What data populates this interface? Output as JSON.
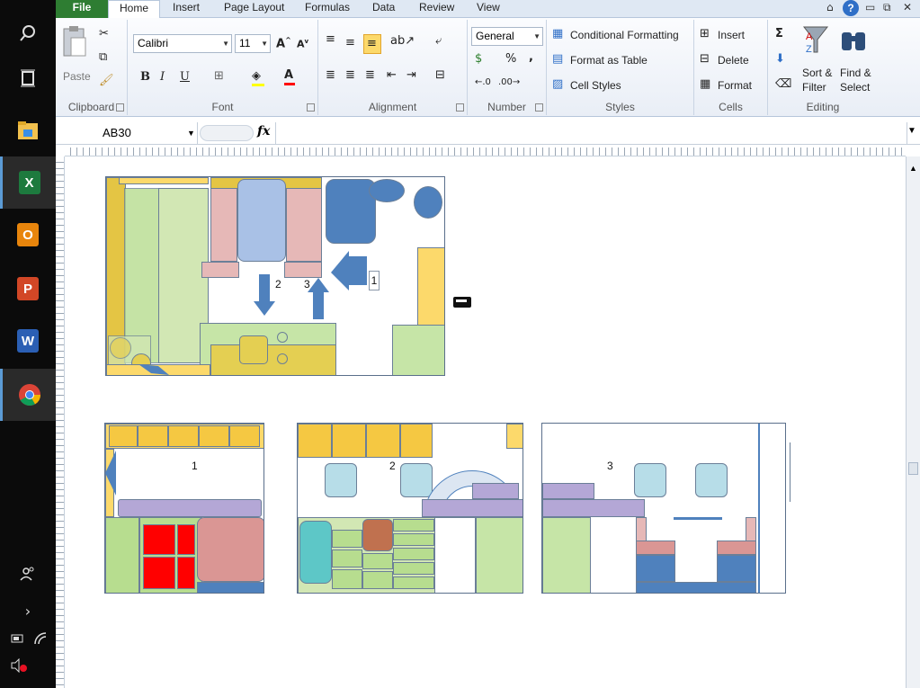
{
  "ribbon_tabs": [
    "File",
    "Home",
    "Insert",
    "Page Layout",
    "Formulas",
    "Data",
    "Review",
    "View"
  ],
  "clipboard": {
    "paste": "Paste",
    "group": "Clipboard"
  },
  "font": {
    "name": "Calibri",
    "size": "11",
    "group": "Font",
    "bold": "B",
    "italic": "I",
    "underline": "U"
  },
  "alignment": {
    "group": "Alignment"
  },
  "number": {
    "format": "General",
    "percent": "%",
    "comma": ",",
    "group": "Number"
  },
  "styles": {
    "conditional": "Conditional Formatting",
    "format_table": "Format as Table",
    "cell_styles": "Cell Styles",
    "group": "Styles"
  },
  "cells": {
    "insert": "Insert",
    "delete": "Delete",
    "format": "Format",
    "group": "Cells"
  },
  "editing": {
    "sort": "Sort &",
    "filter": "Filter",
    "find": "Find &",
    "select": "Select",
    "group": "Editing",
    "sum": "Σ"
  },
  "formula_bar": {
    "name_box": "AB30",
    "fx": "fx",
    "value": ""
  },
  "plan_labels": {
    "arrow1": "1",
    "arrow2": "2",
    "arrow3": "3",
    "view1": "1",
    "view2": "2",
    "view3": "3"
  },
  "taskbar_icons": [
    "search-icon",
    "task-view-icon",
    "file-explorer-icon",
    "excel-icon",
    "outlook-icon",
    "powerpoint-icon",
    "word-icon",
    "chrome-icon",
    "people-icon",
    "chevron-right-icon",
    "battery-icon",
    "wifi-icon",
    "volume-muted-icon"
  ],
  "app_letters": {
    "excel": "X",
    "outlook": "O",
    "powerpoint": "P",
    "word": "W"
  },
  "colors": {
    "excel_green": "#2e7d32",
    "plan_yellow": "#f5c842",
    "plan_blue": "#4f81bd",
    "plan_green": "#b7dd8f",
    "plan_pink": "#e6b8b7",
    "plan_purple": "#b4a7d6",
    "plan_red": "#ff0000",
    "plan_light_blue": "#b7dde8"
  }
}
